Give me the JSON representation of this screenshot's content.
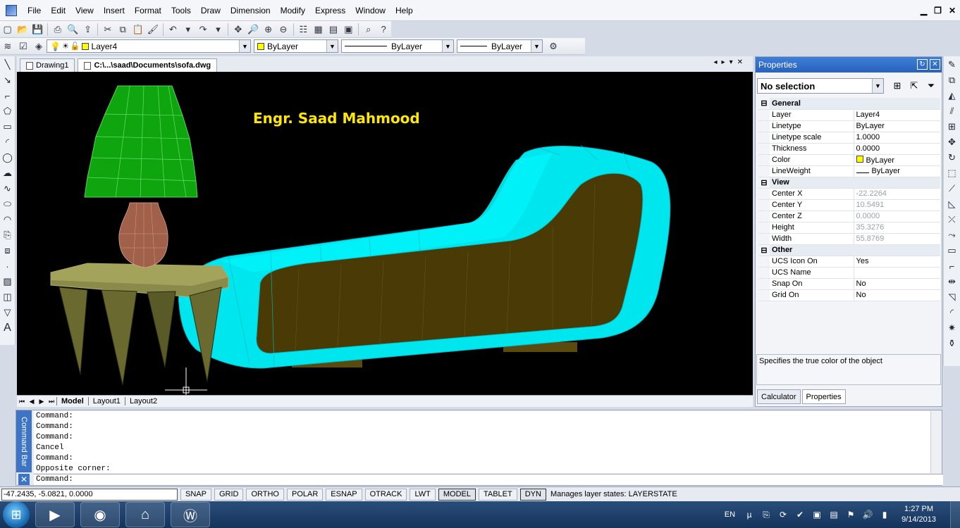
{
  "menu": [
    "File",
    "Edit",
    "View",
    "Insert",
    "Format",
    "Tools",
    "Draw",
    "Dimension",
    "Modify",
    "Express",
    "Window",
    "Help"
  ],
  "icons": {
    "app": "app-icon",
    "minimize": "minimize-icon",
    "restore": "restore-icon",
    "close": "close-icon"
  },
  "layer_toolbar": {
    "layer": "Layer4",
    "color": "ByLayer",
    "linetype": "ByLayer",
    "lineweight": "ByLayer",
    "layer_swatch": "#ffff00"
  },
  "doc_tabs": [
    "Drawing1",
    "C:\\...\\saad\\Documents\\sofa.dwg"
  ],
  "viewport": {
    "annotation": "Engr. Saad Mahmood",
    "annotation_color": "#ffe800"
  },
  "layout_tabs": [
    "Model",
    "Layout1",
    "Layout2"
  ],
  "properties": {
    "title": "Properties",
    "selection": "No selection",
    "general_label": "General",
    "general": [
      {
        "name": "Layer",
        "value": "Layer4"
      },
      {
        "name": "Linetype",
        "value": "ByLayer"
      },
      {
        "name": "Linetype scale",
        "value": "1.0000"
      },
      {
        "name": "Thickness",
        "value": "0.0000"
      },
      {
        "name": "Color",
        "value": "ByLayer"
      },
      {
        "name": "LineWeight",
        "value": "ByLayer"
      }
    ],
    "view_label": "View",
    "view": [
      {
        "name": "Center X",
        "value": "-22.2264"
      },
      {
        "name": "Center Y",
        "value": "10.5491"
      },
      {
        "name": "Center Z",
        "value": "0.0000"
      },
      {
        "name": "Height",
        "value": "35.3276"
      },
      {
        "name": "Width",
        "value": "55.8769"
      }
    ],
    "other_label": "Other",
    "other": [
      {
        "name": "UCS Icon On",
        "value": "Yes"
      },
      {
        "name": "UCS Name",
        "value": ""
      },
      {
        "name": "Snap On",
        "value": "No"
      },
      {
        "name": "Grid On",
        "value": "No"
      }
    ],
    "description": "Specifies the true color of the object",
    "tabs": [
      "Calculator",
      "Properties"
    ]
  },
  "command": {
    "tab_label": "Command Bar",
    "history": [
      "Command:",
      "Command:",
      "Command:",
      "Cancel",
      "Command:",
      "Opposite corner:"
    ],
    "prompt": "Command:"
  },
  "status": {
    "coords": "-47.2435,  -5.0821,  0.0000",
    "buttons": [
      "SNAP",
      "GRID",
      "ORTHO",
      "POLAR",
      "ESNAP",
      "OTRACK",
      "LWT",
      "MODEL",
      "TABLET",
      "DYN"
    ],
    "message": "Manages layer states: LAYERSTATE"
  },
  "taskbar": {
    "lang": "EN",
    "time": "1:27 PM",
    "date": "9/14/2013"
  }
}
